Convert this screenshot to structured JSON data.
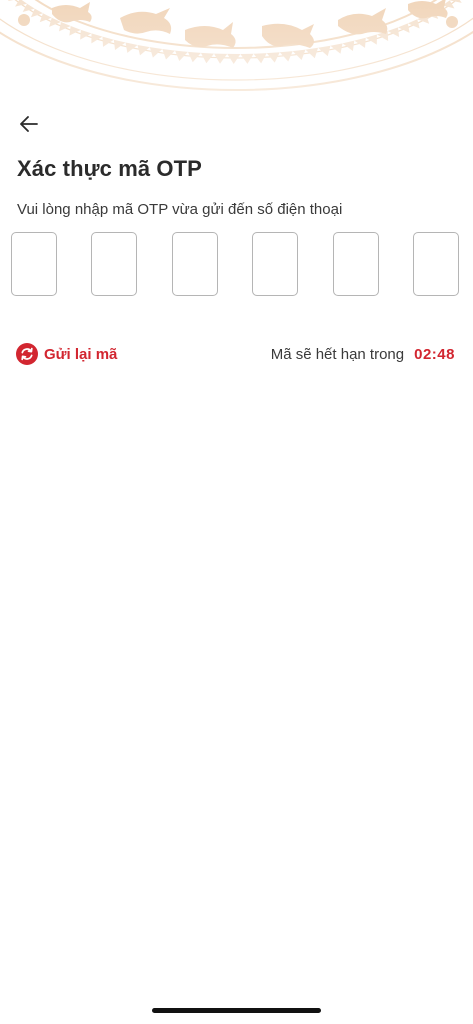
{
  "header": {
    "back_icon": "arrow-left-icon",
    "pattern": "drum-motif-pattern",
    "pattern_color": "#f3dcc4"
  },
  "title": "Xác thực mã OTP",
  "subtitle": "Vui lòng nhập mã OTP vừa gửi đến số điện thoại",
  "otp": {
    "length": 6,
    "values": [
      "",
      "",
      "",
      "",
      "",
      ""
    ]
  },
  "resend": {
    "icon": "refresh-icon",
    "label": "Gửi lại mã"
  },
  "expiry": {
    "label": "Mã sẽ hết hạn trong",
    "timer": "02:48"
  },
  "colors": {
    "accent": "#d22630",
    "text": "#2b2b2b",
    "box_border": "#b5b5b5"
  }
}
